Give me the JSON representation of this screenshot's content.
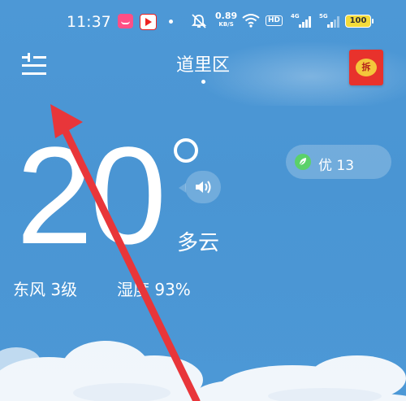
{
  "status_bar": {
    "time": "11:37",
    "net_speed_value": "0.89",
    "net_speed_unit": "KB/S",
    "hd_label": "HD",
    "signal_1_label": "4G",
    "signal_2_label": "5G",
    "battery": "100"
  },
  "header": {
    "city": "道里区",
    "red_packet_label": "拆"
  },
  "weather": {
    "temperature": "20",
    "condition": "多云",
    "wind": "东风 3级",
    "humidity": "湿度 93%"
  },
  "aqi": {
    "label": "优 13",
    "color": "#5bd16a"
  },
  "colors": {
    "sky": "#4a95d3",
    "annotation_arrow": "#e8363a",
    "red_packet": "#e8322c"
  },
  "icons": [
    "menu-icon",
    "speaker-icon",
    "leaf-icon",
    "degree-icon",
    "wifi-icon",
    "mute-bell-icon",
    "battery-icon"
  ]
}
